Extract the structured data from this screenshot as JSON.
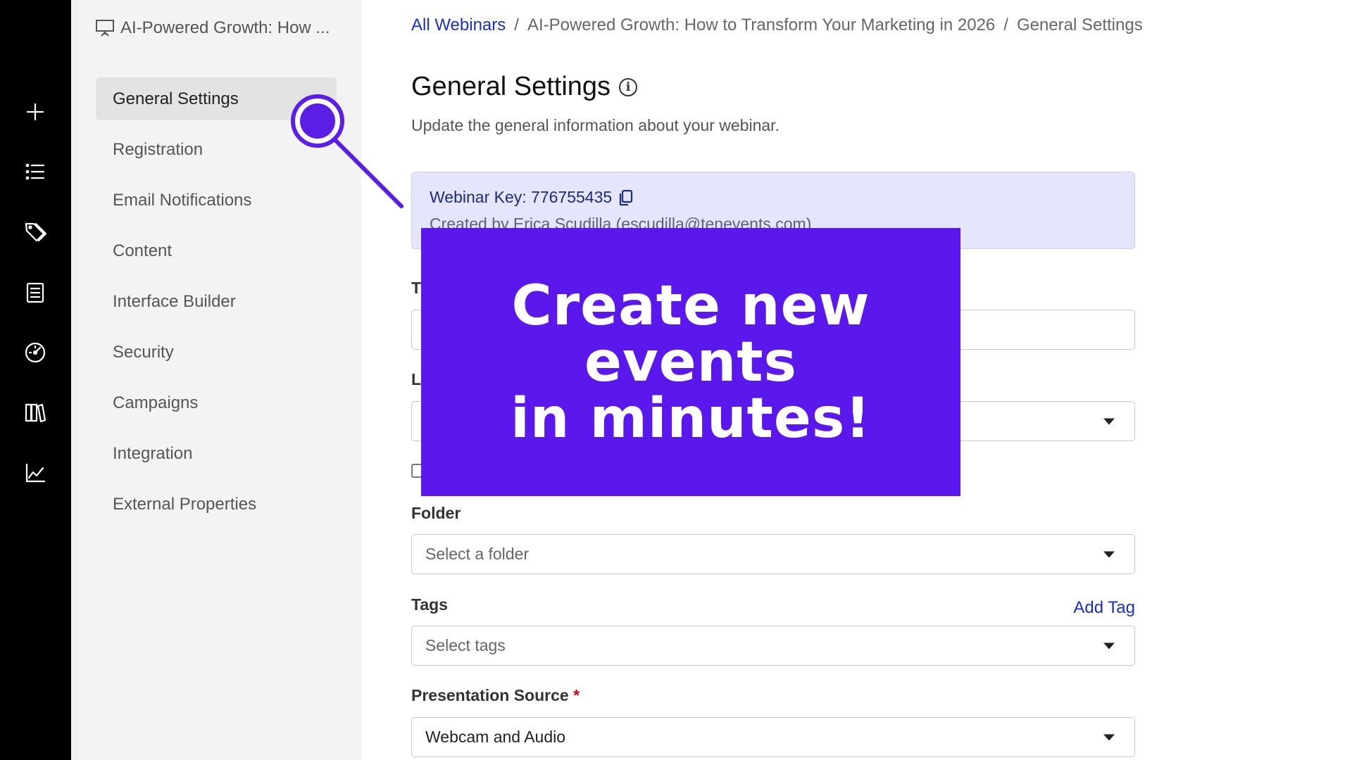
{
  "rail": {
    "items": [
      {
        "name": "create-icon"
      },
      {
        "name": "list-icon"
      },
      {
        "name": "tags-icon"
      },
      {
        "name": "forms-icon"
      },
      {
        "name": "dashboard-icon"
      },
      {
        "name": "library-icon"
      },
      {
        "name": "analytics-icon"
      }
    ]
  },
  "sidebar": {
    "title": "AI-Powered Growth: How ...",
    "items": [
      {
        "label": "General Settings",
        "active": true
      },
      {
        "label": "Registration"
      },
      {
        "label": "Email Notifications"
      },
      {
        "label": "Content"
      },
      {
        "label": "Interface Builder"
      },
      {
        "label": "Security"
      },
      {
        "label": "Campaigns"
      },
      {
        "label": "Integration"
      },
      {
        "label": "External Properties"
      }
    ]
  },
  "breadcrumb": {
    "root": "All Webinars",
    "webinar": "AI-Powered Growth: How to Transform Your Marketing in 2026",
    "current": "General Settings",
    "separator": "/"
  },
  "header": {
    "title": "General Settings",
    "subtitle": "Update the general information about your webinar."
  },
  "key_box": {
    "key_label": "Webinar Key: 776755435",
    "created_by": "Created by Erica Scudilla (escudilla@tenevents.com)"
  },
  "form": {
    "title_label_fragment": "T",
    "language_label_fragment": "L",
    "folder_label": "Folder",
    "folder_placeholder": "Select a folder",
    "tags_label": "Tags",
    "tags_placeholder": "Select tags",
    "add_tag": "Add Tag",
    "presentation_label": "Presentation Source",
    "required_mark": "*",
    "presentation_value": "Webcam and Audio"
  },
  "promo": {
    "line1": "Create new",
    "line2": "events",
    "line3": "in minutes!",
    "color": "#5a18ec"
  },
  "colors": {
    "accent_link": "#1a2fc4",
    "callout": "#5a1ee6",
    "key_box_bg": "#e5e6fb"
  }
}
